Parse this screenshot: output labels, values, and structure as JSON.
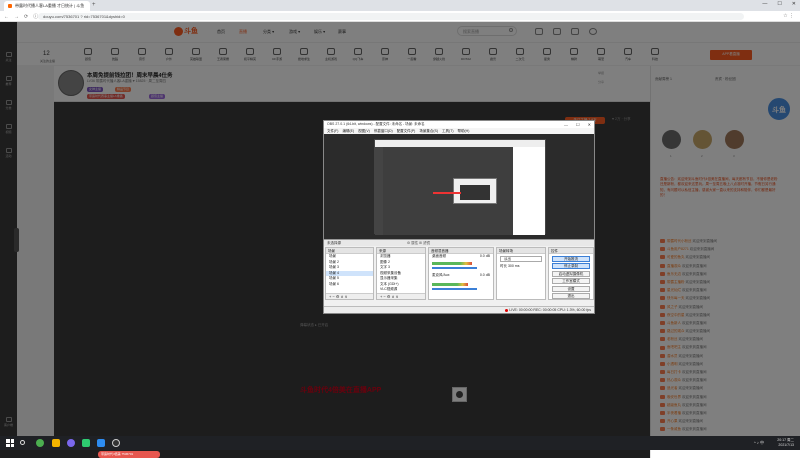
{
  "browser": {
    "tab_title": "带露时代播人客LA重播 才日统计 | 斗鱼",
    "new_tab_symbol": "+",
    "window_controls": [
      "—",
      "☐",
      "✕"
    ],
    "nav": [
      "←",
      "→",
      "⟳",
      "ⓘ"
    ],
    "url": "douyu.com/7536701 ? rid=7536701&dyshid=0",
    "extras": [
      "☆",
      "⋮"
    ]
  },
  "site_header": {
    "logo": "斗鱼",
    "menu": [
      {
        "label": "首页",
        "active": false
      },
      {
        "label": "直播",
        "active": true
      },
      {
        "label": "分类 ▾",
        "active": false
      },
      {
        "label": "游戏 ▾",
        "active": false
      },
      {
        "label": "娱乐 ▾",
        "active": false
      },
      {
        "label": "赛事",
        "active": false
      }
    ],
    "search_placeholder": "搜索直播"
  },
  "left_rail": [
    "关注",
    "推荐",
    "分类",
    "视频",
    "活动"
  ],
  "left_rail_bottom": "客户端",
  "category_nav": {
    "follow_count": "12",
    "follow_label": "关注的主播",
    "items": [
      "颜值",
      "舞蹈",
      "音乐",
      "户外",
      "英雄联盟",
      "王者荣耀",
      "和平精英",
      "CF手游",
      "绝地求生",
      "主机游戏",
      "QQ飞车",
      "原神",
      "一起看",
      "穿越火线",
      "DOTA2",
      "魔兽",
      "二次元",
      "星秀",
      "棋牌",
      "萌宠",
      "汽车",
      "科技"
    ],
    "popup": "APP看直播"
  },
  "streamer": {
    "title": "本周免提前钱拉团！周末早晨4仕务",
    "meta": "LV36  带露时代播人客LA重播  ♥ 15825  · 周二至周四",
    "tags": [
      {
        "text": "女神主播",
        "color": "#7e57c2"
      },
      {
        "text": "精品节目",
        "color": "#ff7f50"
      },
      {
        "text": "带露时代赛事主播LA重播",
        "color": "#e6564e"
      },
      {
        "text": "颜值主播",
        "color": "#9c6ade"
      }
    ],
    "report": "举报",
    "share": "分享",
    "follow_button": "关注主播 7.9万",
    "stats": "♥ 2万  · 分享"
  },
  "player": {
    "float_label": "弹幕状态 ▸ 已开启",
    "danmu": "斗鱼时代4倍美在直播APP"
  },
  "right_panel": {
    "tab1": "贡献周榜 1",
    "tab2": "贵宾 · 粉丝团",
    "mascot": "斗鱼",
    "ranks": [
      "1",
      "2",
      "3"
    ],
    "notice": "直播公告：欢迎来到斗鱼时代4倍美在直播间，每天都有节目，不管你是老粉还是新粉，都欢迎来这里玩。周一至周五晚上八点准时开播，节假日另行通知，有问题可以私信主播，感谢大家一直以来的支持和陪伴，你们都是最好的！",
    "chat": [
      {
        "nick": "带露时代小粉丝",
        "msg": "欢迎来到直播间"
      },
      {
        "nick": "斗鱼用户8271",
        "msg": "欢迎来到直播间"
      },
      {
        "nick": "可爱的鱼丸",
        "msg": "欢迎来到直播间"
      },
      {
        "nick": "直播观众",
        "msg": "欢迎来到直播间"
      },
      {
        "nick": "鱼乐无边",
        "msg": "欢迎来到直播间"
      },
      {
        "nick": "带露主播粉",
        "msg": "欢迎来到直播间"
      },
      {
        "nick": "星光灿烂",
        "msg": "欢迎来到直播间"
      },
      {
        "nick": "快乐每一天",
        "msg": "欢迎来到直播间"
      },
      {
        "nick": "风之子",
        "msg": "欢迎来到直播间"
      },
      {
        "nick": "夜空中的星",
        "msg": "欢迎来到直播间"
      },
      {
        "nick": "斗鱼新人",
        "msg": "欢迎来到直播间"
      },
      {
        "nick": "路过的观众",
        "msg": "欢迎来到直播间"
      },
      {
        "nick": "老粉丝",
        "msg": "欢迎来到直播间"
      },
      {
        "nick": "鱼吧吧主",
        "msg": "欢迎来到直播间"
      },
      {
        "nick": "潜水员",
        "msg": "欢迎来到直播间"
      },
      {
        "nick": "小透明",
        "msg": "欢迎来到直播间"
      },
      {
        "nick": "每日打卡",
        "msg": "欢迎来到直播间"
      },
      {
        "nick": "热心观众",
        "msg": "欢迎来到直播间"
      },
      {
        "nick": "追光者",
        "msg": "欢迎来到直播间"
      },
      {
        "nick": "晚安世界",
        "msg": "欢迎来到直播间"
      },
      {
        "nick": "超级鱼丸",
        "msg": "欢迎来到直播间"
      },
      {
        "nick": "半夜看播",
        "msg": "欢迎来到直播间"
      },
      {
        "nick": "开心果",
        "msg": "欢迎来到直播间"
      },
      {
        "nick": "一条咸鱼",
        "msg": "欢迎来到直播间"
      },
      {
        "nick": "新来的",
        "msg": "欢迎来到直播间"
      }
    ]
  },
  "bottom_badge": "带露时代4倍美 7536701",
  "obs": {
    "title": "OBS 27.0.1 (64-bit, windows) - 配置文件: 未命名 - 场景: 未命名",
    "menu": [
      "文件(F)",
      "编辑(E)",
      "视图(V)",
      "停靠窗口(D)",
      "配置文件(P)",
      "场景集合(S)",
      "工具(T)",
      "帮助(H)"
    ],
    "scene_bar": "未选择源",
    "scene_bar_right": "⚙ 属性  ⊞ 滤镜",
    "docks": {
      "scenes": {
        "title": "场景",
        "items": [
          "场景",
          "场景 2",
          "场景 3",
          "场景 4",
          "场景 5",
          "场景 6"
        ],
        "selected": 3
      },
      "sources": {
        "title": "来源",
        "items": [
          "浏览器",
          "图像 2",
          "文字 3",
          "视频采集设备",
          "显示器采集",
          "文本 (GDI+)",
          "VLC视频源",
          "图像"
        ]
      },
      "mixer": {
        "title": "音频混音器",
        "track1": "桌面音频",
        "track1_db": "0.0 dB",
        "track2": "麦克风/Aux",
        "track2_db": "0.0 dB"
      },
      "transitions": {
        "title": "场景转场",
        "type": "淡出",
        "duration_label": "时长",
        "duration": "300 ms"
      },
      "controls": {
        "title": "控件",
        "buttons": [
          "开始推流",
          "停止录制",
          "启动虚拟摄像机",
          "工作室模式",
          "设置",
          "退出"
        ],
        "active": [
          0,
          1
        ]
      }
    },
    "footer_symbols": "+  −  ⚙  ∧  ∨",
    "status": "LIVE: 00:00:00   REC: 00:00:05   CPU: 1.3%, 60.00 fps",
    "window_controls": [
      "—",
      "☐",
      "✕"
    ]
  },
  "taskbar": {
    "time": "20:17 周二",
    "date": "2021/7/13",
    "tray": "^ ♪ 中"
  }
}
